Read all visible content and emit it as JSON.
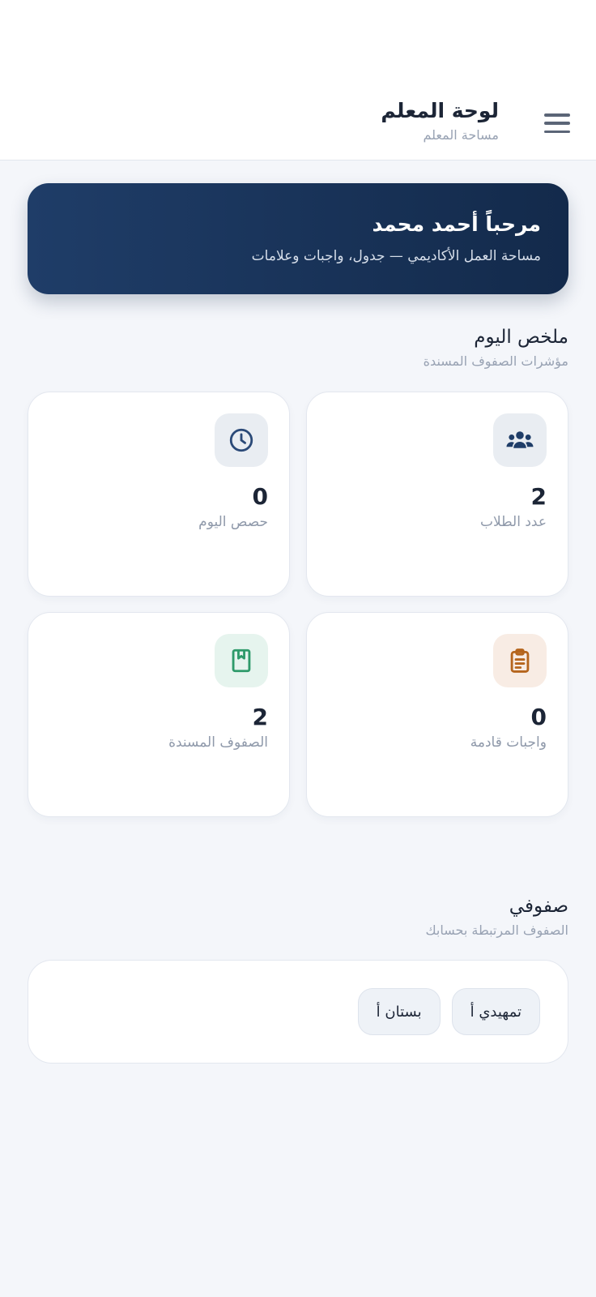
{
  "header": {
    "title": "لوحة المعلم",
    "subtitle": "مساحة المعلم",
    "menu_icon": "menu-icon"
  },
  "welcome": {
    "title": "مرحباً أحمد محمد",
    "subtitle": "مساحة العمل الأكاديمي — جدول، واجبات وعلامات"
  },
  "summary": {
    "title": "ملخص اليوم",
    "subtitle": "مؤشرات الصفوف المسندة",
    "cards": [
      {
        "icon": "students-icon",
        "value": "2",
        "label": "عدد الطلاب",
        "icon_bg": "#e9edf2",
        "icon_color": "#1f3d68"
      },
      {
        "icon": "clock-icon",
        "value": "0",
        "label": "حصص اليوم",
        "icon_bg": "#e9edf2",
        "icon_color": "#2b4a78"
      },
      {
        "icon": "clipboard-icon",
        "value": "0",
        "label": "واجبات قادمة",
        "icon_bg": "#f8ece4",
        "icon_color": "#b5651d"
      },
      {
        "icon": "bookmark-book-icon",
        "value": "2",
        "label": "الصفوف المسندة",
        "icon_bg": "#e6f4ee",
        "icon_color": "#2e9a6a"
      }
    ]
  },
  "classes": {
    "title": "صفوفي",
    "subtitle": "الصفوف المرتبطة بحسابك",
    "items": [
      "تمهيدي أ",
      "بستان أ"
    ]
  }
}
